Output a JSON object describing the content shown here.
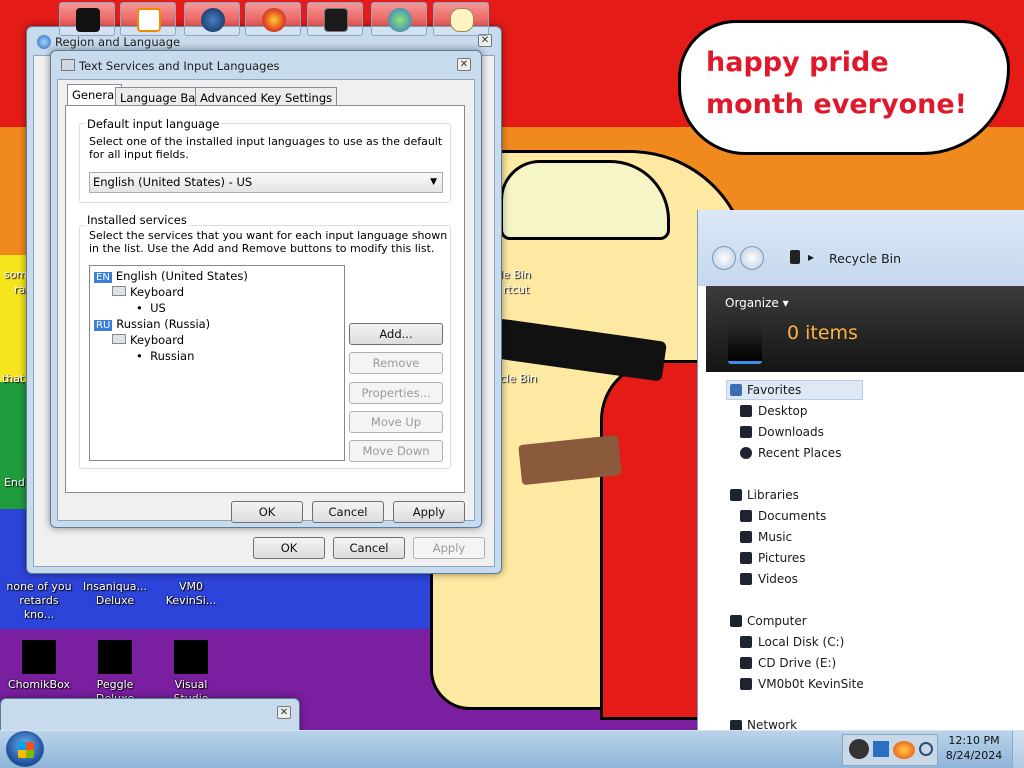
{
  "wallpaper": {
    "speech_bubble": "happy pride month everyone!",
    "desktop_icons": [
      {
        "label": "none of you retards kno..."
      },
      {
        "label": "Insaniqua... Deluxe"
      },
      {
        "label": "VM0 KevinSi..."
      },
      {
        "label": "ChomikBox"
      },
      {
        "label": "Peggle Deluxe"
      },
      {
        "label": "Visual Studio"
      }
    ],
    "partial_labels": [
      "som",
      "ra",
      "that",
      "End",
      "le Bin",
      "rtcut",
      "cle Bin"
    ]
  },
  "region_dialog": {
    "title": "Region and Language",
    "buttons": {
      "ok": "OK",
      "cancel": "Cancel",
      "apply": "Apply"
    }
  },
  "tsil_dialog": {
    "title": "Text Services and Input Languages",
    "tabs": [
      "General",
      "Language Bar",
      "Advanced Key Settings"
    ],
    "default_group": {
      "legend": "Default input language",
      "description": "Select one of the installed input languages to use as the default for all input fields.",
      "selected": "English (United States) - US"
    },
    "installed_group": {
      "legend": "Installed services",
      "description": "Select the services that you want for each input language shown in the list. Use the Add and Remove buttons to modify this list.",
      "tree": {
        "en_badge": "EN",
        "en_label": "English (United States)",
        "en_keyboard": "Keyboard",
        "en_layout": "US",
        "ru_badge": "RU",
        "ru_label": "Russian (Russia)",
        "ru_keyboard": "Keyboard",
        "ru_layout": "Russian"
      },
      "side_buttons": {
        "add": "Add...",
        "remove": "Remove",
        "properties": "Properties...",
        "move_up": "Move Up",
        "move_down": "Move Down"
      }
    },
    "buttons": {
      "ok": "OK",
      "cancel": "Cancel",
      "apply": "Apply"
    }
  },
  "explorer": {
    "location": "Recycle Bin",
    "organize": "Organize",
    "item_count": "0 items",
    "nav": {
      "favorites": "Favorites",
      "desktop": "Desktop",
      "downloads": "Downloads",
      "recent": "Recent Places",
      "libraries": "Libraries",
      "documents": "Documents",
      "music": "Music",
      "pictures": "Pictures",
      "videos": "Videos",
      "computer": "Computer",
      "local_disk": "Local Disk (C:)",
      "cd_drive": "CD Drive (E:)",
      "vm_site": "VM0b0t KevinSite",
      "network": "Network"
    }
  },
  "taskbar": {
    "time": "12:10 PM",
    "date": "8/24/2024",
    "apps": [
      "media-player",
      "blank-window",
      "globe",
      "firefox",
      "monitor",
      "network-globe",
      "speech-bubble"
    ]
  },
  "colors": {
    "speech_text": "#e0182c",
    "taskbar": "#a9c7e4",
    "explorer_dark": "#1e1e1e"
  }
}
